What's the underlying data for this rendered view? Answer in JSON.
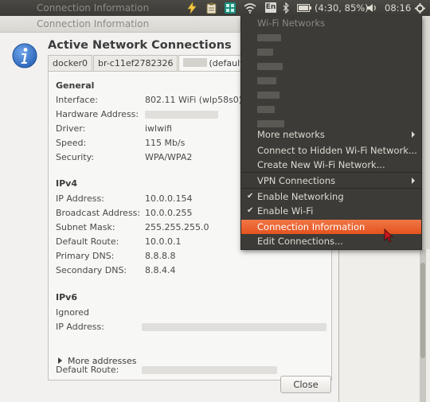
{
  "top_panel": {
    "app_title": "Connection Information",
    "lang": "En",
    "battery": "(4:30, 85%)",
    "clock": "08:16"
  },
  "dialog": {
    "title": "Connection Information",
    "heading": "Active Network Connections",
    "tabs": [
      {
        "label": "docker0"
      },
      {
        "label": "br-c11ef2782326"
      },
      {
        "label": "(default)"
      }
    ],
    "general": {
      "title": "General",
      "rows": [
        {
          "label": "Interface:",
          "value": "802.11 WiFi (wlp58s0)"
        },
        {
          "label": "Hardware Address:",
          "value": ""
        },
        {
          "label": "Driver:",
          "value": "iwlwifi"
        },
        {
          "label": "Speed:",
          "value": "115 Mb/s"
        },
        {
          "label": "Security:",
          "value": "WPA/WPA2"
        }
      ]
    },
    "ipv4": {
      "title": "IPv4",
      "rows": [
        {
          "label": "IP Address:",
          "value": "10.0.0.154"
        },
        {
          "label": "Broadcast Address:",
          "value": "10.0.0.255"
        },
        {
          "label": "Subnet Mask:",
          "value": "255.255.255.0"
        },
        {
          "label": "Default Route:",
          "value": "10.0.0.1"
        },
        {
          "label": "Primary DNS:",
          "value": "8.8.8.8"
        },
        {
          "label": "Secondary DNS:",
          "value": "8.8.4.4"
        }
      ]
    },
    "ipv6": {
      "title": "IPv6",
      "status": "Ignored",
      "ip_label": "IP Address:",
      "more_label": "More addresses",
      "route_label": "Default Route:"
    },
    "close_label": "Close"
  },
  "menu": {
    "header": "Wi-Fi Networks",
    "items": [
      {
        "label": "More networks",
        "submenu": true
      },
      {
        "label": "Connect to Hidden Wi-Fi Network..."
      },
      {
        "label": "Create New Wi-Fi Network..."
      },
      {
        "label": "VPN Connections",
        "submenu": true
      },
      {
        "label": "Enable Networking",
        "checked": true
      },
      {
        "label": "Enable Wi-Fi",
        "checked": true
      },
      {
        "label": "Connection Information",
        "highlighted": true
      },
      {
        "label": "Edit Connections..."
      }
    ],
    "check_glyph": "✔"
  },
  "colors": {
    "panel": "#3b3a36",
    "menu_bg": "#3c3b37",
    "highlight": "#e4531f",
    "info_icon": "#2e6cc4"
  },
  "icons": [
    "bolt-icon",
    "clipboard-icon",
    "app-grid-icon",
    "wifi-icon",
    "keyboard-lang-icon",
    "bluetooth-icon",
    "battery-icon",
    "volume-icon",
    "gear-icon",
    "info-icon",
    "mouse-pointer-icon"
  ]
}
